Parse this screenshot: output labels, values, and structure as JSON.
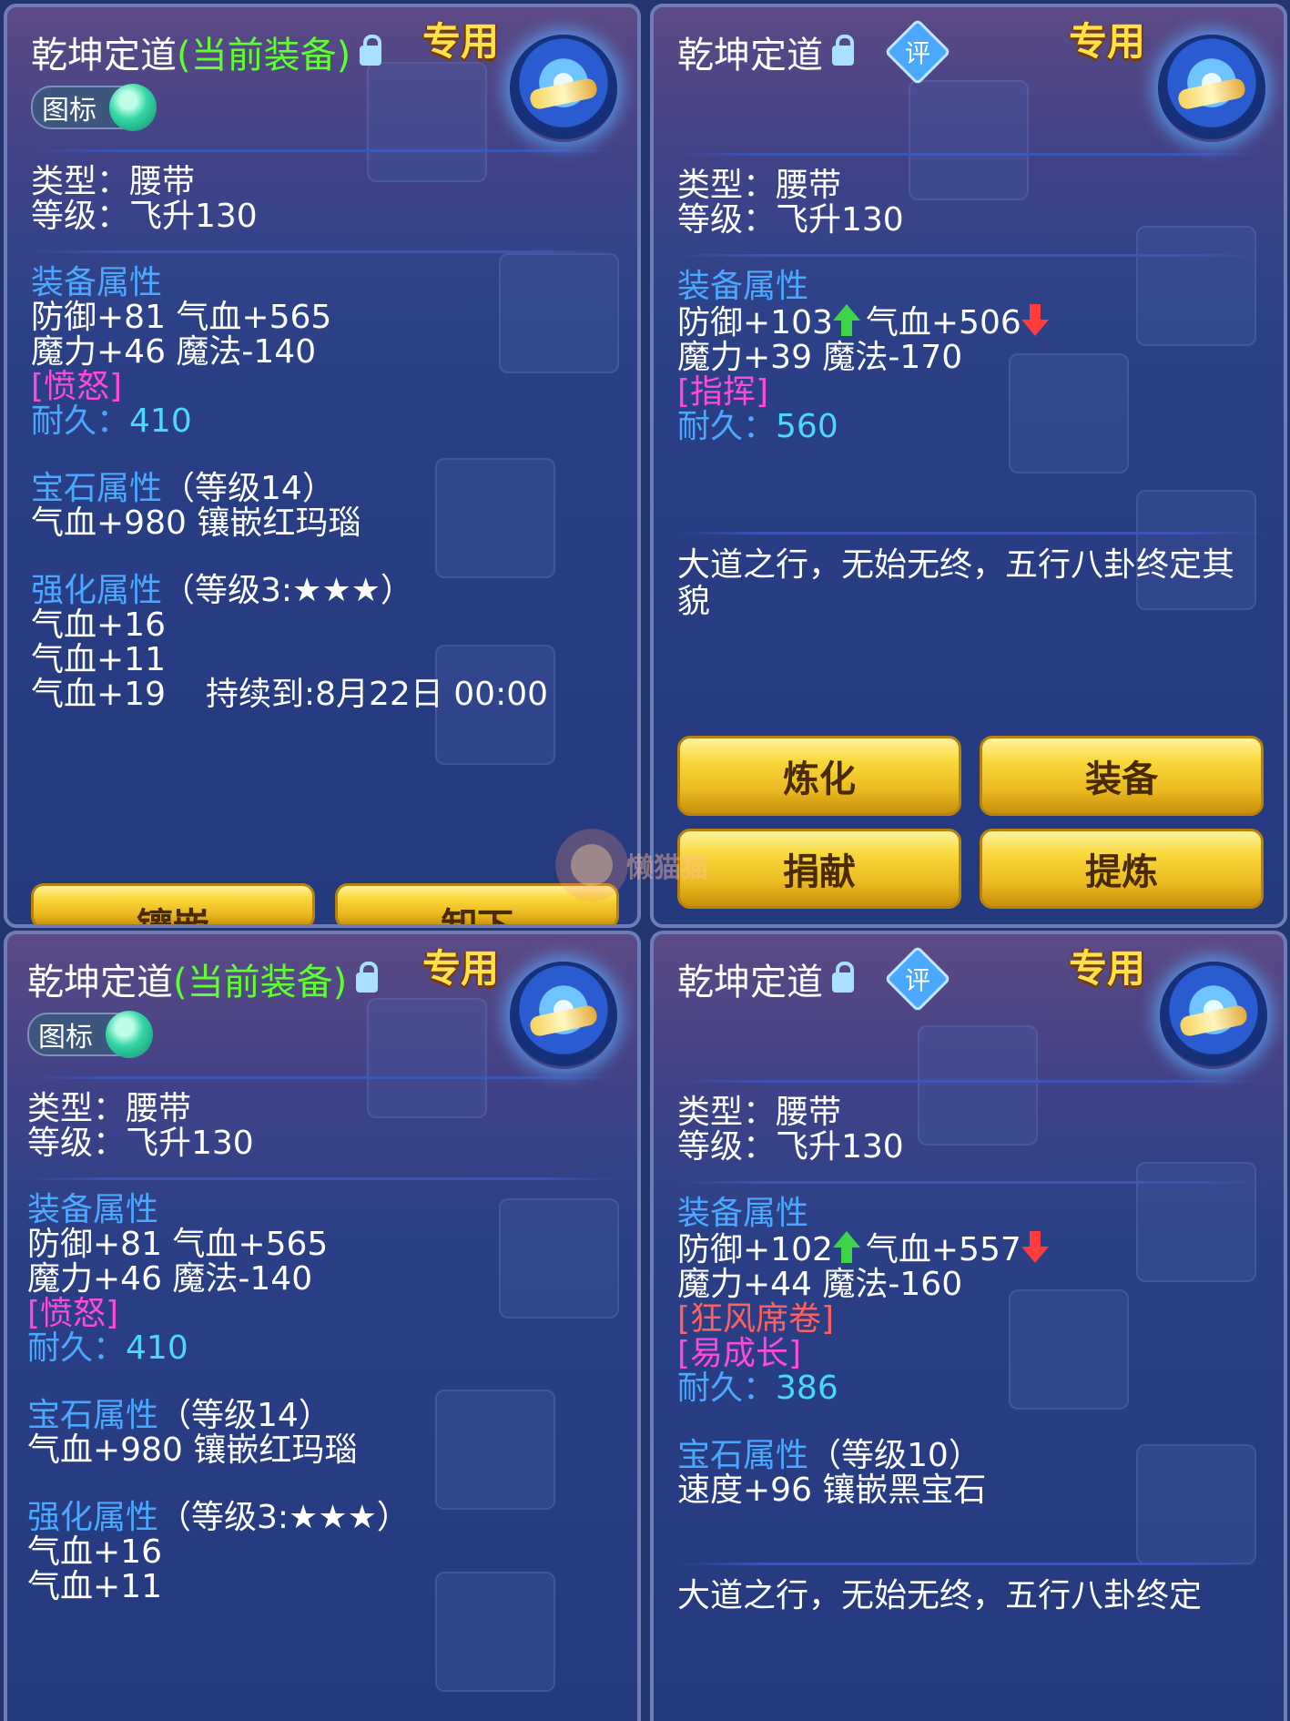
{
  "panels": [
    {
      "title": "乾坤定道",
      "equipped": "(当前装备)",
      "special": "专用",
      "toggle_label": "图标",
      "type": "类型：腰带",
      "level": "等级：飞升130",
      "equip_attr_title": "装备属性",
      "stat1": "防御+81 气血+565",
      "stat2": "魔力+46 魔法-140",
      "special_attr": "[愤怒]",
      "durability_label": "耐久：",
      "durability_value": "410",
      "gem_title": "宝石属性",
      "gem_level": "（等级14）",
      "gem_stat": "气血+980 镶嵌红玛瑙",
      "enhance_title": "强化属性",
      "enhance_level": "（等级3:★★★）",
      "enhance_stats": [
        "气血+16",
        "气血+11",
        "气血+19"
      ],
      "duration": "持续到:8月22日 00:00",
      "buttons": [
        "镶嵌",
        "卸下"
      ]
    },
    {
      "title": "乾坤定道",
      "special": "专用",
      "rate": "评",
      "type": "类型：腰带",
      "level": "等级：飞升130",
      "equip_attr_title": "装备属性",
      "stat1a": "防御+103",
      "stat1b": "气血+506",
      "stat2": "魔力+39 魔法-170",
      "special_attr": "[指挥]",
      "durability_label": "耐久：",
      "durability_value": "560",
      "description": "大道之行，无始无终，五行八卦终定其貌",
      "buttons": [
        "炼化",
        "装备",
        "捐献",
        "提炼"
      ],
      "watermark": "懒猫猫"
    },
    {
      "title": "乾坤定道",
      "equipped": "(当前装备)",
      "special": "专用",
      "toggle_label": "图标",
      "type": "类型：腰带",
      "level": "等级：飞升130",
      "equip_attr_title": "装备属性",
      "stat1": "防御+81 气血+565",
      "stat2": "魔力+46 魔法-140",
      "special_attr": "[愤怒]",
      "durability_label": "耐久：",
      "durability_value": "410",
      "gem_title": "宝石属性",
      "gem_level": "（等级14）",
      "gem_stat": "气血+980 镶嵌红玛瑙",
      "enhance_title": "强化属性",
      "enhance_level": "（等级3:★★★）",
      "enhance_stats": [
        "气血+16",
        "气血+11"
      ]
    },
    {
      "title": "乾坤定道",
      "special": "专用",
      "rate": "评",
      "type": "类型：腰带",
      "level": "等级：飞升130",
      "equip_attr_title": "装备属性",
      "stat1a": "防御+102",
      "stat1b": "气血+557",
      "stat2": "魔力+44 魔法-160",
      "special_attr1": "[狂风席卷]",
      "special_attr2": "[易成长]",
      "durability_label": "耐久：",
      "durability_value": "386",
      "gem_title": "宝石属性",
      "gem_level": "（等级10）",
      "gem_stat": "速度+96 镶嵌黑宝石",
      "description": "大道之行，无始无终，五行八卦终定"
    }
  ],
  "colors": {
    "section_blue": "#4aa8ff",
    "equipped_green": "#5fff2e",
    "special_magenta": "#ff4ad9",
    "special_red": "#ff5f5f",
    "durability_cyan": "#4ad8ff",
    "special_gold": "#ffe14a"
  }
}
